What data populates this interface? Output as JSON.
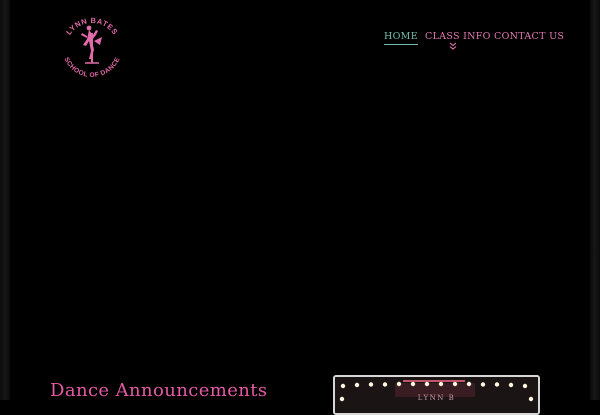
{
  "colors": {
    "background": "#000000",
    "accent_pink": "#e26aa9",
    "nav_active": "#6fbfaa",
    "nav_text": "#e27bb5",
    "title_pink": "#e35aa5",
    "bulb": "#fff7e0"
  },
  "logo": {
    "text_top": "LYNN BATES",
    "text_bottom": "SCHOOL OF DANCE",
    "icon": "dancer-icon"
  },
  "nav": {
    "items": [
      {
        "label": "HOME",
        "active": true
      },
      {
        "label": "CLASS INFO",
        "active": false,
        "has_dropdown": true,
        "dropdown_icon": "double-chevron-down-icon"
      },
      {
        "label": "CONTACT US",
        "active": false
      }
    ]
  },
  "main": {
    "announcements_title": "Dance Announcements",
    "marquee_text": "LYNN B"
  }
}
